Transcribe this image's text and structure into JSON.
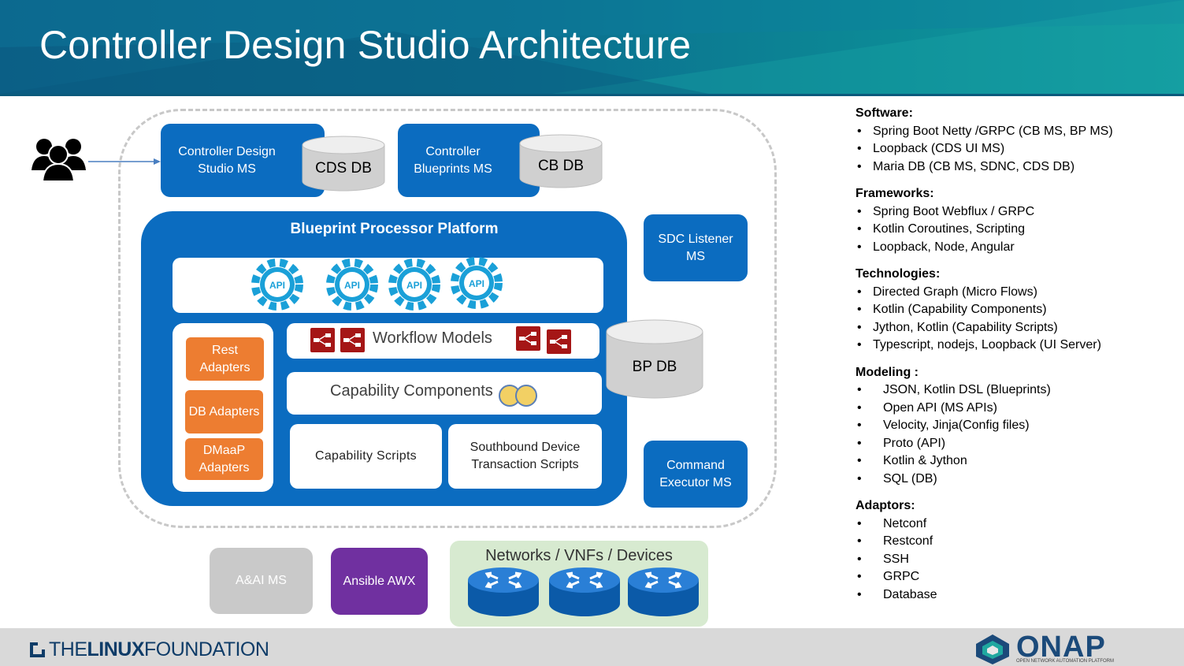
{
  "header": {
    "title": "Controller Design Studio Architecture"
  },
  "top": {
    "cds_ms": "Controller Design Studio MS",
    "cds_db": "CDS DB",
    "cb_ms": "Controller Blueprints MS",
    "cb_db": "CB DB"
  },
  "right": {
    "sdc_listener": "SDC Listener MS",
    "bp_db": "BP DB",
    "command_executor": "Command Executor MS"
  },
  "platform": {
    "title": "Blueprint Processor Platform",
    "api_label": "API",
    "adapters": [
      "Rest Adapters",
      "DB Adapters",
      "DMaaP Adapters"
    ],
    "workflow_models": "Workflow Models",
    "capability_components": "Capability Components",
    "capability_scripts": "Capability Scripts",
    "southbound_scripts": "Southbound Device Transaction Scripts"
  },
  "bottom": {
    "aai": "A&AI MS",
    "ansible": "Ansible AWX",
    "networks": "Networks / VNFs / Devices"
  },
  "colors": {
    "blue": "#0b6cc0",
    "orange": "#ed7d31",
    "purple": "#7030a0",
    "gray_box": "#c9c9c9",
    "green_panel": "#d7ead0",
    "api_gear": "#1aa0d8",
    "workflow_icon": "#a51616"
  },
  "icons": [
    "users-icon",
    "api-gear-icon",
    "workflow-icon",
    "capability-coins-icon",
    "router-icon"
  ],
  "side": {
    "sections": [
      {
        "title": "Software:",
        "items": [
          "Spring Boot Netty /GRPC (CB MS, BP MS)",
          "Loopback (CDS UI MS)",
          "Maria DB (CB MS, SDNC, CDS DB)"
        ]
      },
      {
        "title": "Frameworks:",
        "items": [
          "Spring Boot Webflux / GRPC",
          "Kotlin Coroutines, Scripting",
          "Loopback, Node, Angular"
        ]
      },
      {
        "title": "Technologies:",
        "items": [
          "Directed Graph (Micro Flows)",
          "Kotlin (Capability Components)",
          "Jython, Kotlin (Capability Scripts)",
          "Typescript, nodejs, Loopback (UI Server)"
        ]
      },
      {
        "title": "Modeling :",
        "items": [
          "JSON, Kotlin DSL (Blueprints)",
          "Open API (MS APIs)",
          "Velocity, Jinja(Config files)",
          "Proto (API)",
          "Kotlin & Jython",
          "SQL (DB)"
        ]
      },
      {
        "title": "Adaptors:",
        "items": [
          "Netconf",
          "Restconf",
          "SSH",
          "GRPC",
          "Database"
        ]
      }
    ]
  },
  "footer": {
    "linux_pre": "THE",
    "linux_bold": "LINUX",
    "linux_post": "FOUNDATION",
    "onap": "ONAP",
    "onap_sub": "OPEN NETWORK AUTOMATION PLATFORM"
  }
}
